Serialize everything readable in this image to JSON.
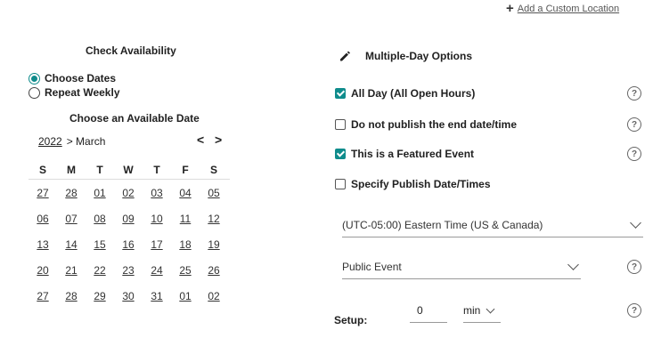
{
  "add_location": {
    "label": "Add a Custom Location"
  },
  "availability": {
    "title": "Check Availability",
    "options": [
      {
        "label": "Choose Dates",
        "selected": true
      },
      {
        "label": "Repeat Weekly",
        "selected": false
      }
    ],
    "calendar_title": "Choose an Available Date",
    "year": "2022",
    "month": "> March",
    "prev": "<",
    "next": ">",
    "days_of_week": [
      "S",
      "M",
      "T",
      "W",
      "T",
      "F",
      "S"
    ],
    "weeks": [
      [
        "27",
        "28",
        "01",
        "02",
        "03",
        "04",
        "05"
      ],
      [
        "06",
        "07",
        "08",
        "09",
        "10",
        "11",
        "12"
      ],
      [
        "13",
        "14",
        "15",
        "16",
        "17",
        "18",
        "19"
      ],
      [
        "20",
        "21",
        "22",
        "23",
        "24",
        "25",
        "26"
      ],
      [
        "27",
        "28",
        "29",
        "30",
        "31",
        "01",
        "02"
      ]
    ]
  },
  "options": {
    "multi_day_label": "Multiple-Day Options",
    "checkboxes": [
      {
        "label": "All Day (All Open Hours)",
        "checked": true
      },
      {
        "label": "Do not publish the end date/time",
        "checked": false
      },
      {
        "label": "This is a Featured Event",
        "checked": true
      },
      {
        "label": "Specify Publish Date/Times",
        "checked": false
      }
    ],
    "timezone": "(UTC-05:00) Eastern Time (US & Canada)",
    "event_type": "Public Event",
    "setup_label": "Setup:",
    "setup_value": "0",
    "setup_unit": "min",
    "help_glyph": "?",
    "accent": "#0f8c8c"
  }
}
